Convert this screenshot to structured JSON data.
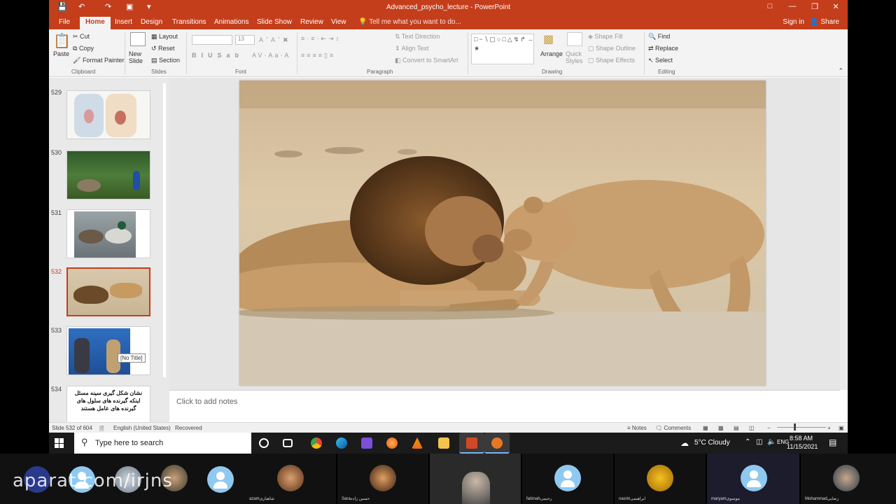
{
  "window": {
    "title": "Advanced_psycho_lecture - PowerPoint",
    "controls": [
      "□",
      "—",
      "❐",
      "✕"
    ]
  },
  "tabs": [
    "File",
    "Home",
    "Insert",
    "Design",
    "Transitions",
    "Animations",
    "Slide Show",
    "Review",
    "View"
  ],
  "tell_me": "Tell me what you want to do...",
  "account": {
    "sign_in": "Sign in",
    "share": "Share"
  },
  "ribbon": {
    "clipboard": {
      "paste": "Paste",
      "cut": "Cut",
      "copy": "Copy",
      "format_painter": "Format Painter",
      "label": "Clipboard"
    },
    "slides": {
      "new_slide": "New Slide",
      "layout": "Layout",
      "reset": "Reset",
      "section": "Section",
      "label": "Slides"
    },
    "font": {
      "size": "13",
      "label": "Font"
    },
    "paragraph": {
      "text_direction": "Text Direction",
      "align_text": "Align Text",
      "convert_smartart": "Convert to SmartArt",
      "label": "Paragraph"
    },
    "drawing": {
      "arrange": "Arrange",
      "quick_styles": "Quick Styles",
      "shape_fill": "Shape Fill",
      "shape_outline": "Shape Outline",
      "shape_effects": "Shape Effects",
      "label": "Drawing"
    },
    "editing": {
      "find": "Find",
      "replace": "Replace",
      "select": "Select",
      "label": "Editing"
    }
  },
  "thumbnails": [
    {
      "number": "529",
      "kind": "anatomy"
    },
    {
      "number": "530",
      "kind": "peacock"
    },
    {
      "number": "531",
      "kind": "ducks"
    },
    {
      "number": "532",
      "kind": "lions",
      "selected": true
    },
    {
      "number": "533",
      "kind": "people",
      "tooltip": "[No Title]"
    },
    {
      "number": "534",
      "kind": "text",
      "text": "نشان شکل گیری سینه مسئل اینکه گیرنده های سلول های گیرنده های عامل هستند"
    }
  ],
  "notes_placeholder": "Click to add notes",
  "status": {
    "slide_info": "Slide 532 of 604",
    "language": "English (United States)",
    "recovered": "Recovered",
    "notes": "Notes",
    "comments": "Comments"
  },
  "taskbar": {
    "search_placeholder": "Type here to search",
    "weather": "5°C Cloudy",
    "time": "8:58 AM",
    "date": "11/15/2021",
    "lang": "ENG"
  },
  "participants": [
    {
      "name": "",
      "kind": "default"
    },
    {
      "name": "",
      "kind": "default"
    },
    {
      "name": "",
      "kind": "photo"
    },
    {
      "name": "",
      "kind": "default"
    },
    {
      "name": "azamشاهیاری",
      "kind": "photo"
    },
    {
      "name": "Saraحسین زاده",
      "kind": "photo"
    },
    {
      "name": "",
      "kind": "video"
    },
    {
      "name": "fatimahرحیمی",
      "kind": "default"
    },
    {
      "name": "nasrinابراهیمی",
      "kind": "flowers"
    },
    {
      "name": "maryamموسوی",
      "kind": "default"
    },
    {
      "name": "Mohammadرضایی",
      "kind": "photo"
    }
  ],
  "watermark": "aparat.com/irjns",
  "colors": {
    "accent": "#c43e1c",
    "taskbar": "#1b1b1b"
  }
}
